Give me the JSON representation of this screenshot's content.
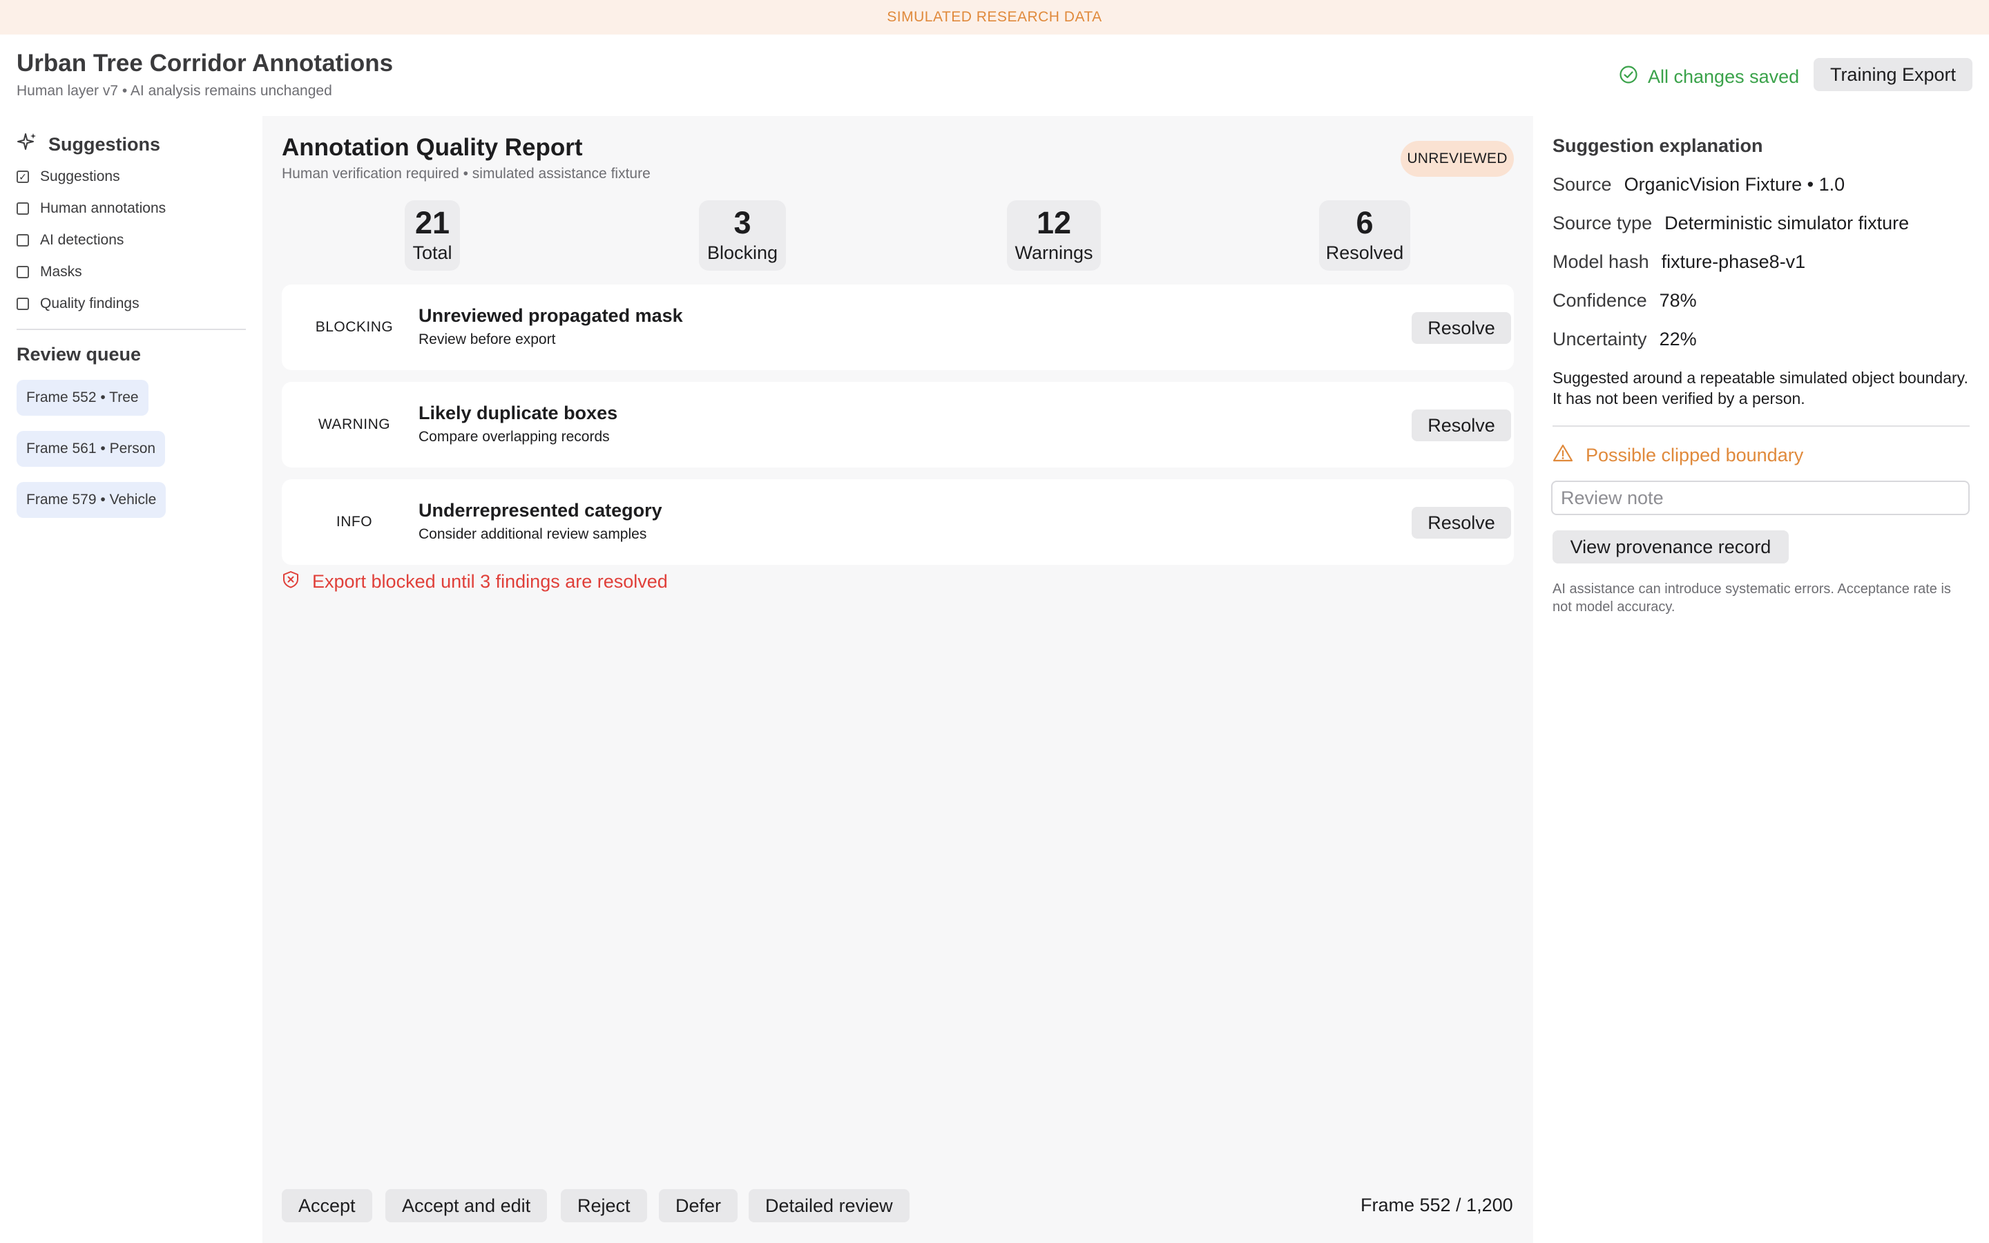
{
  "banner": "SIMULATED RESEARCH DATA",
  "header": {
    "title": "Urban Tree Corridor Annotations",
    "subtitle": "Human layer v7 • AI analysis remains unchanged",
    "save_status": "All changes saved",
    "export_label": "Training Export"
  },
  "sidebar": {
    "title": "Suggestions",
    "layers": [
      {
        "label": "Suggestions",
        "checked": true
      },
      {
        "label": "Human annotations",
        "checked": false
      },
      {
        "label": "AI detections",
        "checked": false
      },
      {
        "label": "Masks",
        "checked": false
      },
      {
        "label": "Quality findings",
        "checked": false
      }
    ],
    "queue_title": "Review queue",
    "queue": [
      "Frame 552 • Tree",
      "Frame 561 • Person",
      "Frame 579 • Vehicle"
    ]
  },
  "report": {
    "title": "Annotation Quality Report",
    "subtitle": "Human verification required • simulated assistance fixture",
    "status": "UNREVIEWED",
    "stats": [
      {
        "value": "21",
        "label": "Total"
      },
      {
        "value": "3",
        "label": "Blocking"
      },
      {
        "value": "12",
        "label": "Warnings"
      },
      {
        "value": "6",
        "label": "Resolved"
      }
    ],
    "findings": [
      {
        "severity": "BLOCKING",
        "title": "Unreviewed propagated mask",
        "detail": "Review before export",
        "action": "Resolve"
      },
      {
        "severity": "WARNING",
        "title": "Likely duplicate boxes",
        "detail": "Compare overlapping records",
        "action": "Resolve"
      },
      {
        "severity": "INFO",
        "title": "Underrepresented category",
        "detail": "Consider additional review samples",
        "action": "Resolve"
      }
    ],
    "blocked_message": "Export blocked until 3 findings are resolved"
  },
  "actions": {
    "accept": "Accept",
    "accept_edit": "Accept and edit",
    "reject": "Reject",
    "defer": "Defer",
    "detailed": "Detailed review",
    "frame": "Frame 552 / 1,200"
  },
  "panel": {
    "title": "Suggestion explanation",
    "meta": [
      {
        "key": "Source",
        "value": "OrganicVision Fixture • 1.0"
      },
      {
        "key": "Source type",
        "value": "Deterministic simulator fixture"
      },
      {
        "key": "Model hash",
        "value": "fixture-phase8-v1"
      },
      {
        "key": "Confidence",
        "value": "78%"
      },
      {
        "key": "Uncertainty",
        "value": "22%"
      }
    ],
    "description": "Suggested around a repeatable simulated object boundary. It has not been verified by a person.",
    "warning": "Possible clipped boundary",
    "note_placeholder": "Review note",
    "provenance_label": "View provenance record",
    "footnote": "AI assistance can introduce systematic errors. Acceptance rate is not model accuracy."
  },
  "colors": {
    "banner_bg": "#fcf0e8",
    "banner_text": "#e08a3c",
    "saved": "#3aa24a",
    "error": "#e0403a",
    "warning": "#e08a3c",
    "queue_bg": "#e8eefb",
    "status_badge_bg": "#fae2d2"
  }
}
